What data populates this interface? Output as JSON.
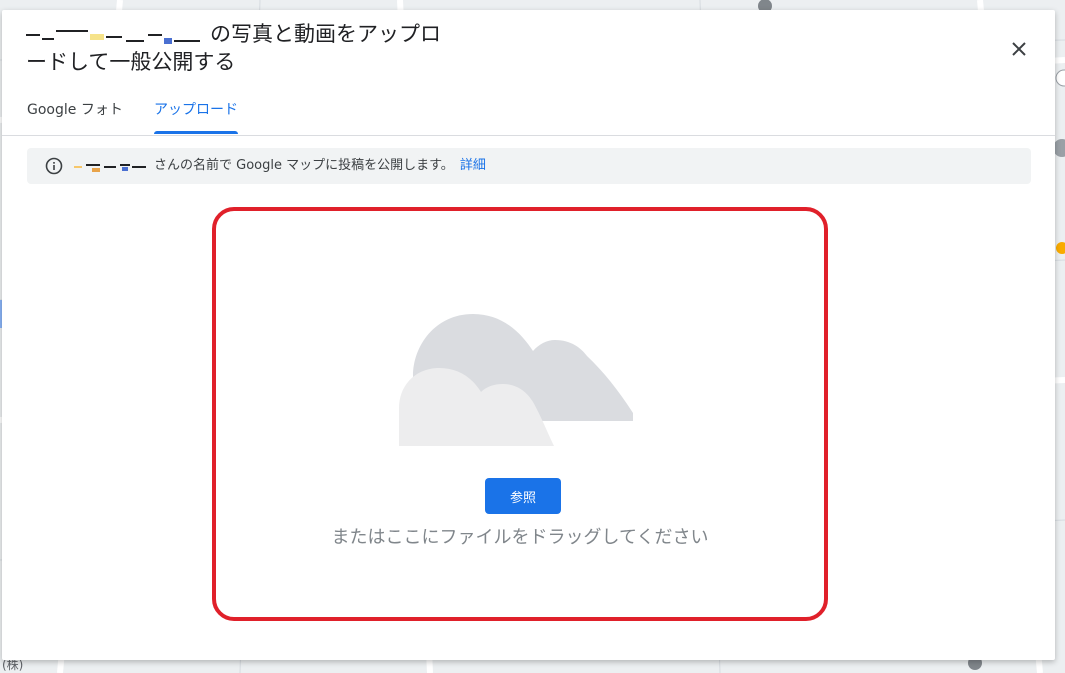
{
  "dialog": {
    "title_suffix": "の写真と動画をアップロードして一般公開する",
    "close_label": "✕"
  },
  "tabs": [
    {
      "label": "Google フォト",
      "active": false
    },
    {
      "label": "アップロード",
      "active": true
    }
  ],
  "info_banner": {
    "text": "さんの名前で Google マップに投稿を公開します。",
    "link": "詳細"
  },
  "drop_zone": {
    "browse_label": "参照",
    "hint": "またはここにファイルをドラッグしてください"
  },
  "map": {
    "labels": [
      "(株)"
    ]
  },
  "colors": {
    "accent": "#1a73e8",
    "highlight_border": "#e0202a",
    "banner_bg": "#f1f3f4",
    "cloud_back": "#dadce0",
    "cloud_front": "#ededee"
  }
}
